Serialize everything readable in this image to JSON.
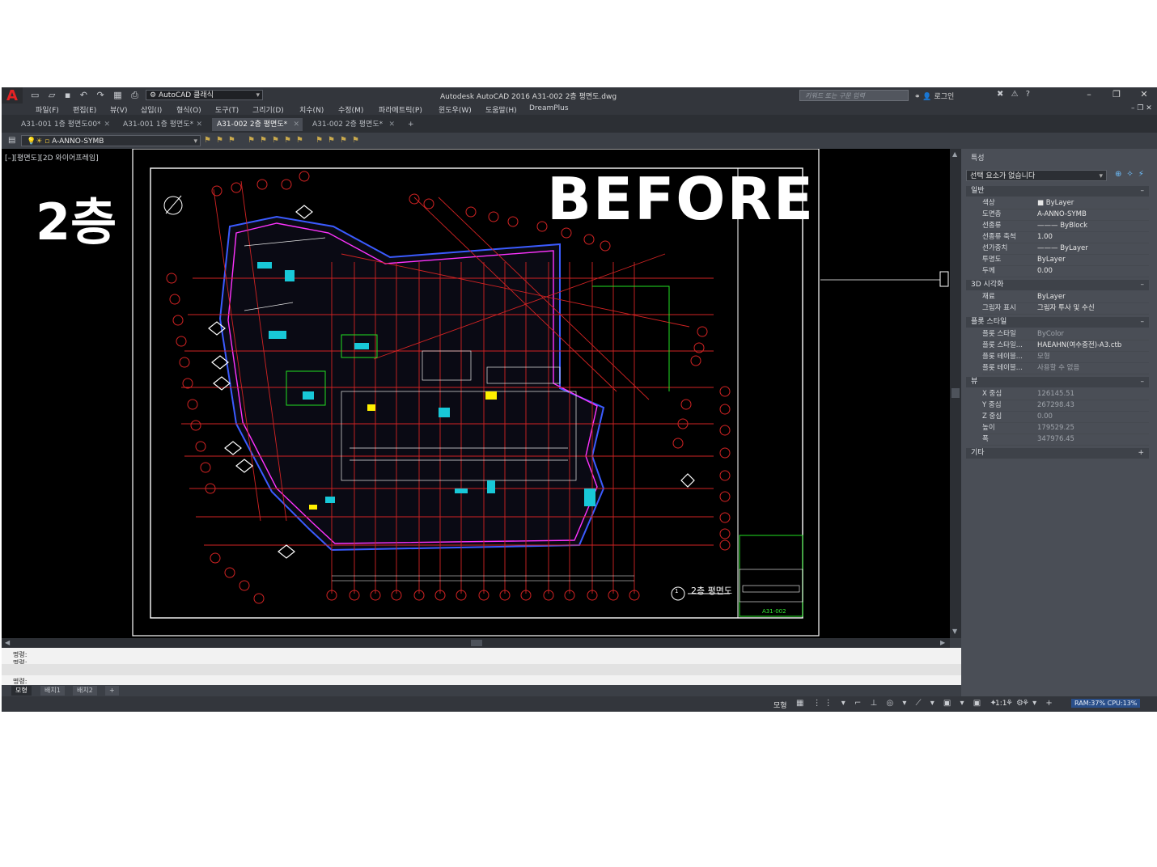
{
  "app": {
    "window_title": "Autodesk AutoCAD 2016    A31-002 2층 평면도.dwg",
    "workspace": "AutoCAD 클래식",
    "search_placeholder": "키워드 또는 구문 입력",
    "login": "로그인",
    "minimize": "–",
    "restore": "❐",
    "close": "✕"
  },
  "menu": [
    "파일(F)",
    "편집(E)",
    "뷰(V)",
    "삽입(I)",
    "형식(O)",
    "도구(T)",
    "그리기(D)",
    "치수(N)",
    "수정(M)",
    "파라메트릭(P)",
    "윈도우(W)",
    "도움말(H)",
    "DreamPlus"
  ],
  "tabs": [
    {
      "label": "A31-001 1층 평면도00*",
      "active": false
    },
    {
      "label": "A31-001 1층 평면도*",
      "active": false
    },
    {
      "label": "A31-002 2층 평면도*",
      "active": true
    },
    {
      "label": "A31-002 2층 평면도*",
      "active": false
    }
  ],
  "tab_close": "✕",
  "tab_add": "+",
  "layer": {
    "current": "A-ANNO-SYMB"
  },
  "viewport": {
    "label": "[–][평면도][2D 와이어프레임]",
    "overlay_floor": "2층",
    "overlay_before": "BEFORE",
    "plan_title": "2층 평면도",
    "plan_number": "1",
    "sheet_number": "A31-002"
  },
  "command": {
    "lines": [
      "명령:",
      "명령:",
      "명령:"
    ]
  },
  "layout_tabs": [
    "모형",
    "배치1",
    "배치2",
    "+"
  ],
  "status": {
    "model": "모형",
    "scale": "1:1",
    "ram": "RAM:37%",
    "cpu": "CPU:13%"
  },
  "properties": {
    "title": "특성",
    "selection": "선택 요소가 없습니다",
    "sections": [
      {
        "title": "일반",
        "toggle": "–",
        "rows": [
          {
            "k": "색상",
            "v": "■ ByLayer"
          },
          {
            "k": "도면층",
            "v": "A-ANNO-SYMB"
          },
          {
            "k": "선종류",
            "v": "——— ByBlock"
          },
          {
            "k": "선종류 축척",
            "v": "1.00"
          },
          {
            "k": "선가중치",
            "v": "——— ByLayer"
          },
          {
            "k": "투명도",
            "v": "ByLayer"
          },
          {
            "k": "두께",
            "v": "0.00"
          }
        ]
      },
      {
        "title": "3D 시각화",
        "toggle": "–",
        "rows": [
          {
            "k": "재료",
            "v": "ByLayer"
          },
          {
            "k": "그림자 표시",
            "v": "그림자 투사 및 수신"
          }
        ]
      },
      {
        "title": "플롯 스타일",
        "toggle": "–",
        "rows": [
          {
            "k": "플롯 스타일",
            "v": "ByColor"
          },
          {
            "k": "플롯 스타일...",
            "v": "HAEAHN(여수중전)-A3.ctb"
          },
          {
            "k": "플롯 테이블...",
            "v": "모형"
          },
          {
            "k": "플롯 테이블...",
            "v": "사용할 수 없음"
          }
        ]
      },
      {
        "title": "뷰",
        "toggle": "–",
        "rows": [
          {
            "k": "X 중심",
            "v": "126145.51"
          },
          {
            "k": "Y 중심",
            "v": "267298.43"
          },
          {
            "k": "Z 중심",
            "v": "0.00"
          },
          {
            "k": "높이",
            "v": "179529.25"
          },
          {
            "k": "폭",
            "v": "347976.45"
          }
        ]
      },
      {
        "title": "기타",
        "toggle": "+",
        "rows": []
      }
    ]
  }
}
